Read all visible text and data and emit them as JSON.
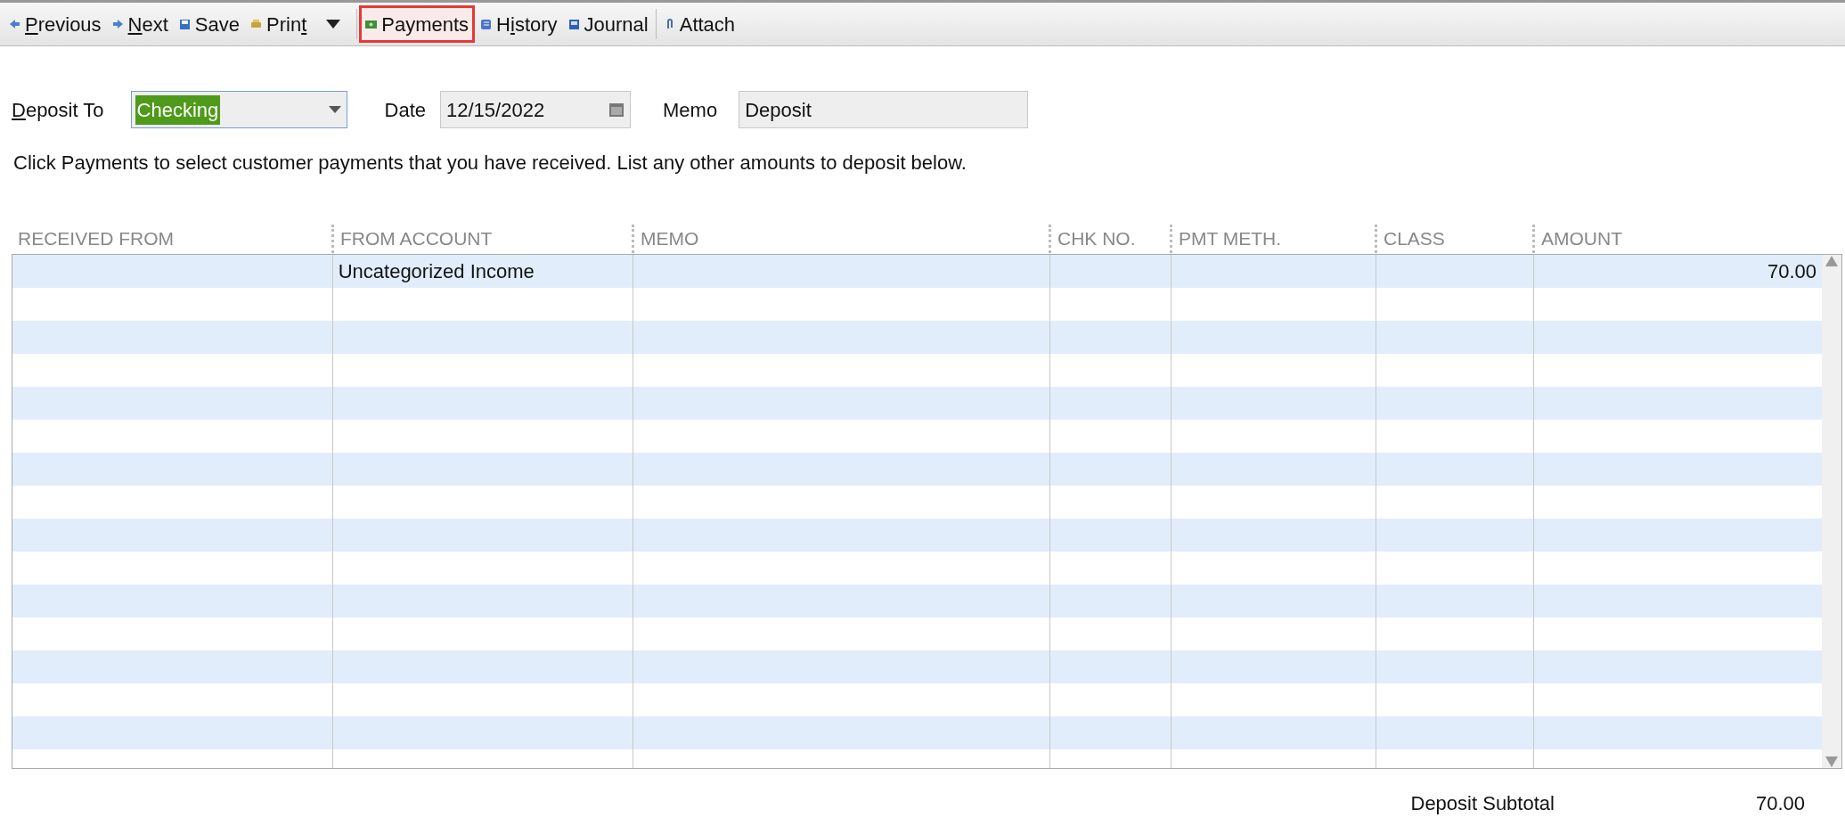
{
  "toolbar": [
    {
      "kind": "prev",
      "key": "P",
      "post": "revious",
      "highlighted": false
    },
    {
      "kind": "next",
      "key": "N",
      "post": "ext",
      "highlighted": false
    },
    {
      "kind": "save",
      "pre": "Save",
      "highlighted": false
    },
    {
      "kind": "print",
      "pre": "Prin",
      "key": "t",
      "highlighted": false
    },
    {
      "kind": "dropdown",
      "highlighted": false
    },
    {
      "kind": "payments",
      "pre": "Payments",
      "highlighted": true
    },
    {
      "kind": "history",
      "pre": "H",
      "key": "i",
      "post": "story",
      "highlighted": false
    },
    {
      "kind": "journal",
      "pre": "Journal",
      "highlighted": false
    },
    {
      "kind": "attach",
      "pre": "Attach",
      "highlighted": false
    }
  ],
  "form": {
    "deposit_to": {
      "label_key": "D",
      "label_rest": "eposit To",
      "value": "Checking"
    },
    "date": {
      "label": "Date",
      "value": "12/15/2022"
    },
    "memo": {
      "label": "Memo",
      "value": "Deposit"
    }
  },
  "instructions": "Click Payments to select customer payments that you have received. List any other amounts to deposit below.",
  "table": {
    "columns": [
      "RECEIVED FROM",
      "FROM ACCOUNT",
      "MEMO",
      "CHK NO.",
      "PMT METH.",
      "CLASS",
      "AMOUNT"
    ],
    "rows": [
      [
        "",
        "Uncategorized Income",
        "",
        "",
        "",
        "",
        "70.00"
      ]
    ]
  },
  "subtotal": {
    "label": "Deposit Subtotal",
    "value": "70.00"
  }
}
